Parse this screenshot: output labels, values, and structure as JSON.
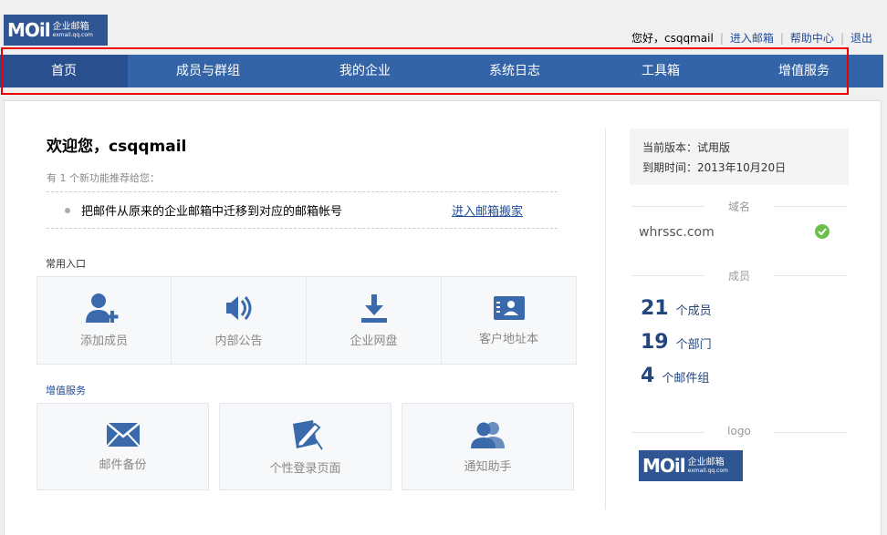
{
  "header": {
    "logo_mail": "MOil",
    "logo_cn": "企业邮箱",
    "logo_domain": "exmail.qq.com",
    "greeting": "您好，csqqmail",
    "links": [
      "进入邮箱",
      "帮助中心",
      "退出"
    ]
  },
  "nav": {
    "items": [
      "首页",
      "成员与群组",
      "我的企业",
      "系统日志",
      "工具箱",
      "增值服务"
    ],
    "active_index": 0
  },
  "main": {
    "welcome": "欢迎您，csqqmail",
    "new_features": "有 1 个新功能推荐给您：",
    "feature_text": "把邮件从原来的企业邮箱中迁移到对应的邮箱帐号",
    "feature_link": "进入邮箱搬家",
    "common_title": "常用入口",
    "common_tiles": [
      {
        "label": "添加成员",
        "icon": "add-user-icon"
      },
      {
        "label": "内部公告",
        "icon": "speaker-icon"
      },
      {
        "label": "企业网盘",
        "icon": "download-icon"
      },
      {
        "label": "客户地址本",
        "icon": "contact-card-icon"
      }
    ],
    "value_title": "增值服务",
    "value_tiles": [
      {
        "label": "邮件备份",
        "icon": "envelope-icon"
      },
      {
        "label": "个性登录页面",
        "icon": "edit-page-icon"
      },
      {
        "label": "通知助手",
        "icon": "users-icon"
      }
    ]
  },
  "side": {
    "version_line": "当前版本：试用版",
    "expiry_line": "到期时间：2013年10月20日",
    "domain_head": "域名",
    "domain": "whrssc.com",
    "member_head": "成员",
    "stats": [
      {
        "num": "21",
        "unit": "个成员"
      },
      {
        "num": "19",
        "unit": "个部门"
      },
      {
        "num": "4",
        "unit": "个邮件组"
      }
    ],
    "logo_head": "logo"
  },
  "colors": {
    "nav_bg": "#3464a8",
    "nav_active": "#2a4f8e",
    "link": "#1e4c9c",
    "stat": "#23467f",
    "highlight_border": "#e00000",
    "check": "#6cbf4a"
  }
}
